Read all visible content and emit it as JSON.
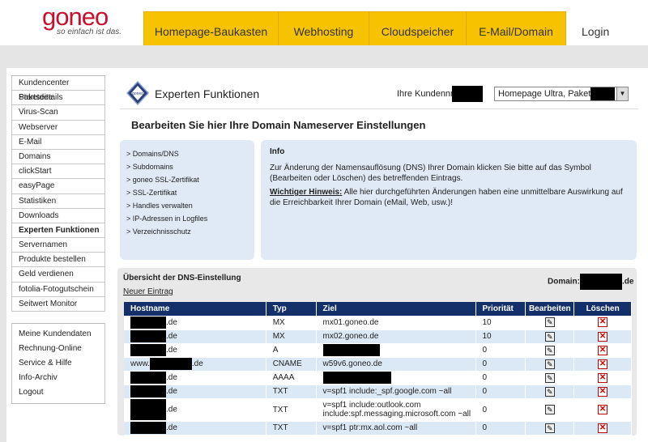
{
  "header": {
    "logo_main": "goneo",
    "logo_sub": "so einfach ist das.",
    "nav": [
      "Homepage-Baukasten",
      "Webhosting",
      "Cloudspeicher",
      "E-Mail/Domain"
    ],
    "login": "Login"
  },
  "sidebar": {
    "items": [
      "Kundencenter Startseite",
      "Paketdetails",
      "Virus-Scan",
      "Webserver",
      "E-Mail",
      "Domains",
      "clickStart",
      "easyPage",
      "Statistiken",
      "Downloads",
      "Experten Funktionen",
      "Servernamen",
      "Produkte bestellen",
      "Geld verdienen",
      "fotolia-Fotogutschein",
      "Seitwert Monitor"
    ],
    "active": "Experten Funktionen",
    "items2": [
      "Meine Kundendaten",
      "Rechnung-Online",
      "Service & Hilfe",
      "Info-Archiv",
      "Logout"
    ]
  },
  "main": {
    "section_title": "Experten Funktionen",
    "kunden_label": "Ihre Kundennr.:",
    "paket_select": "Homepage Ultra, Paket-Id:",
    "page_heading": "Bearbeiten Sie hier Ihre Domain Nameserver Einstellungen"
  },
  "links": [
    "> Domains/DNS",
    "> Subdomains",
    "> goneo SSL-Zertifikat",
    "> SSL-Zertifikat",
    "> Handles verwalten",
    "> IP-Adressen in Logfiles",
    "> Verzeichnisschutz"
  ],
  "info": {
    "title": "Info",
    "text": "Zur Änderung der Namensauflösung (DNS) Ihrer Domain klicken Sie bitte auf das Symbol (Bearbeiten oder Löschen) des betreffenden Eintrags.",
    "warn_label": "Wichtiger Hinweis:",
    "warn_text": " Alle hier durchgeführten Änderungen haben eine unmittelbare Auswirkung auf die Erreichbarkeit Ihrer Domain (eMail, Web, usw.)!"
  },
  "dns": {
    "title": "Übersicht der DNS-Einstellung",
    "domain_label": "Domain:",
    "domain_suffix": ".de",
    "new_entry": "Neuer Eintrag",
    "columns": [
      "Hostname",
      "Typ",
      "Ziel",
      "Priorität",
      "Bearbeiten",
      "Löschen"
    ],
    "rows": [
      {
        "host_prefix": "",
        "host_suffix": ".de",
        "typ": "MX",
        "ziel": "mx01.goneo.de",
        "prio": "10"
      },
      {
        "host_prefix": "",
        "host_suffix": ".de",
        "typ": "MX",
        "ziel": "mx02.goneo.de",
        "prio": "10"
      },
      {
        "host_prefix": "",
        "host_suffix": ".de",
        "typ": "A",
        "ziel": "",
        "prio": "0"
      },
      {
        "host_prefix": "www.",
        "host_suffix": ".de",
        "typ": "CNAME",
        "ziel": "w59v6.goneo.de",
        "prio": "0"
      },
      {
        "host_prefix": "",
        "host_suffix": ".de",
        "typ": "AAAA",
        "ziel": "",
        "prio": "0"
      },
      {
        "host_prefix": "",
        "host_suffix": ".de",
        "typ": "TXT",
        "ziel": "v=spf1 include:_spf.google.com ~all",
        "prio": "0"
      },
      {
        "host_prefix": "",
        "host_suffix": ".de",
        "typ": "TXT",
        "ziel": "v=spf1 include:outlook.com include:spf.messaging.microsoft.com ~all",
        "prio": "0"
      },
      {
        "host_prefix": "",
        "host_suffix": ".de",
        "typ": "TXT",
        "ziel": "v=spf1 ptr:mx.aol.com ~all",
        "prio": "0"
      }
    ]
  }
}
